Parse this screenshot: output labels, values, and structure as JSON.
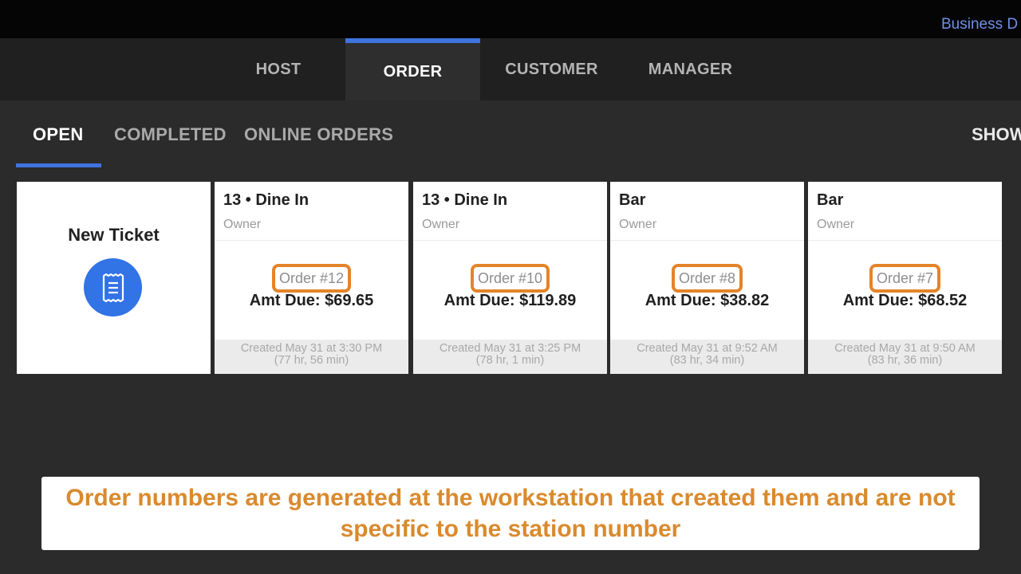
{
  "topbar": {
    "business_link": "Business D"
  },
  "main_nav": {
    "tabs": [
      {
        "label": "HOST"
      },
      {
        "label": "ORDER"
      },
      {
        "label": "CUSTOMER"
      },
      {
        "label": "MANAGER"
      }
    ],
    "active": "ORDER",
    "accent_color": "#3f74e0"
  },
  "sub_nav": {
    "tabs": [
      {
        "label": "OPEN"
      },
      {
        "label": "COMPLETED"
      },
      {
        "label": "ONLINE ORDERS"
      }
    ],
    "active": "OPEN",
    "show_label": "SHOW"
  },
  "new_ticket": {
    "label": "New Ticket",
    "icon": "receipt-icon",
    "icon_bg": "#3273e6"
  },
  "tickets": [
    {
      "title": "13 • Dine In",
      "owner": "Owner",
      "order": "Order #12",
      "amount": "Amt Due: $69.65",
      "created": "Created May 31 at 3:30 PM",
      "elapsed": "(77 hr, 56 min)"
    },
    {
      "title": "13 • Dine In",
      "owner": "Owner",
      "order": "Order #10",
      "amount": "Amt Due: $119.89",
      "created": "Created May 31 at 3:25 PM",
      "elapsed": "(78 hr, 1 min)"
    },
    {
      "title": "Bar",
      "owner": "Owner",
      "order": "Order #8",
      "amount": "Amt Due: $38.82",
      "created": "Created May 31 at 9:52 AM",
      "elapsed": "(83 hr, 34 min)"
    },
    {
      "title": "Bar",
      "owner": "Owner",
      "order": "Order #7",
      "amount": "Amt Due: $68.52",
      "created": "Created May 31 at 9:50 AM",
      "elapsed": "(83 hr, 36 min)"
    }
  ],
  "highlight_color": "#e4842a",
  "caption": {
    "text": "Order numbers are generated at the workstation that created them and are not specific to the station number"
  }
}
